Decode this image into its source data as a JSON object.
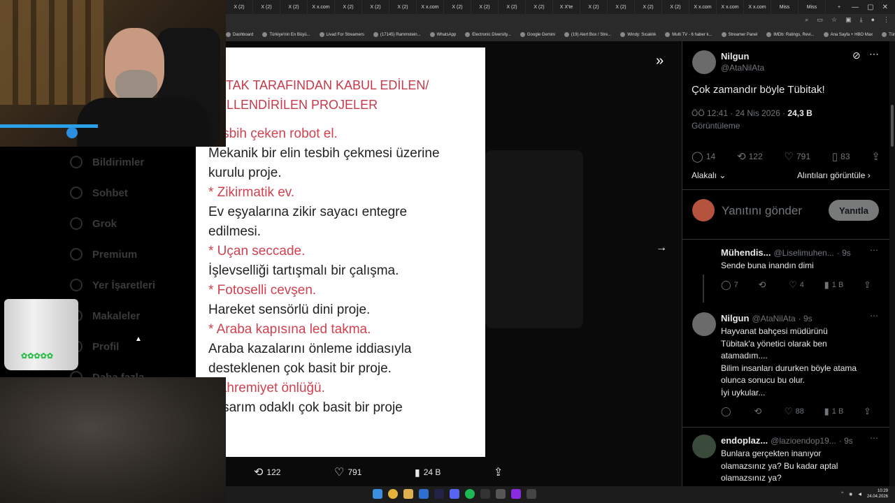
{
  "browser": {
    "tabs": [
      "X (2)",
      "X (2)",
      "X (2)",
      "X x.com",
      "X (2)",
      "X (2)",
      "X (2)",
      "X x.com",
      "X (2)",
      "X (2)",
      "X (2)",
      "X (2)",
      "X X'te",
      "X (2)",
      "X (2)",
      "X (2)",
      "X (2)",
      "X x.com",
      "X x.com",
      "X x.com",
      "Miss",
      "Miss"
    ],
    "bookmarks": [
      "Dashboard",
      "Türkiye'nin En Büyü...",
      "Livad For Streamers",
      "(17145) Rammstein...",
      "WhatsApp",
      "Electronic Diversity...",
      "Google Gemini",
      "(19) Alert Box / Stre...",
      "Windy: Sıcaklık",
      "Multi TV - 6 haber k...",
      "Streamer Panel",
      "IMDb: Ratings, Revi...",
      "Ana Sayfa + HBO Max",
      "Tüm Yer İşaretleri"
    ]
  },
  "left_menu": [
    "Bildirimler",
    "Sohbet",
    "Grok",
    "Premium",
    "Yer İşaretleri",
    "Makaleler",
    "Profil",
    "Daha fazla"
  ],
  "media": {
    "heading_line1": "BİTAK TARAFINDAN KABUL EDİLEN/",
    "heading_line2": "DÜLLENDİRİLEN PROJELER",
    "items": [
      {
        "title": "Tesbih çeken robot el.",
        "desc": "Mekanik bir elin tesbih çekmesi üzerine kurulu proje."
      },
      {
        "title": "* Zikirmatik ev.",
        "desc": "Ev eşyalarına zikir sayacı entegre edilmesi."
      },
      {
        "title": "* Uçan seccade.",
        "desc": "İşlevselliği tartışmalı bir çalışma."
      },
      {
        "title": "* Fotoselli cevşen.",
        "desc": "Hareket sensörlü dini proje."
      },
      {
        "title": "* Araba kapısına led takma.",
        "desc": "Araba kazalarını önleme iddiasıyla desteklenen çok basit bir proje."
      },
      {
        "title": "Mahremiyet önlüğü.",
        "desc": "Tasarım odaklı çok basit bir proje"
      }
    ],
    "bar": {
      "retweets": "122",
      "likes": "791",
      "views": "24 B"
    }
  },
  "tweet": {
    "name": "Nilgun",
    "handle": "@AtaNilAta",
    "text": "Çok zamandır böyle Tübitak!",
    "time": "ÖÖ 12:41 · 24 Nis 2026 ·",
    "views_count": "24,3 B",
    "views_label": "Görüntüleme",
    "stats": {
      "replies": "14",
      "retweets": "122",
      "likes": "791",
      "bookmarks": "83"
    },
    "sort_label": "Alakalı",
    "quotes_link": "Alıntıları görüntüle",
    "reply_placeholder": "Yanıtını gönder",
    "reply_button": "Yanıtla"
  },
  "replies": [
    {
      "name": "Mühendis...",
      "handle": "@Liselimuhen...",
      "time": "· 9s",
      "text": [
        "Sende buna inandın dimi"
      ],
      "replies": "7",
      "retweets": "",
      "likes": "4",
      "views": "1 B"
    },
    {
      "name": "Nilgun",
      "handle": "@AtaNilAta",
      "time": "· 9s",
      "text": [
        "Hayvanat bahçesi müdürünü",
        "Tübitak'a yönetici olarak ben",
        "atamadım....",
        "Bilim insanları dururken böyle atama",
        "olunca sonucu bu olur.",
        "İyi uykular..."
      ],
      "replies": "",
      "retweets": "",
      "likes": "88",
      "views": "1 B"
    },
    {
      "name": "endoplaz...",
      "handle": "@lazioendop19...",
      "time": "· 9s",
      "text": [
        "Bunlara gerçekten inanıyor",
        "olamazsınız ya? Bu kadar aptal",
        "olamazsınız ya?"
      ]
    }
  ],
  "clock": {
    "time": "10:29",
    "date": "24.04.2026"
  },
  "colors": {
    "accent_red": "#d1414f",
    "bg": "#000000",
    "muted": "#71767b"
  }
}
